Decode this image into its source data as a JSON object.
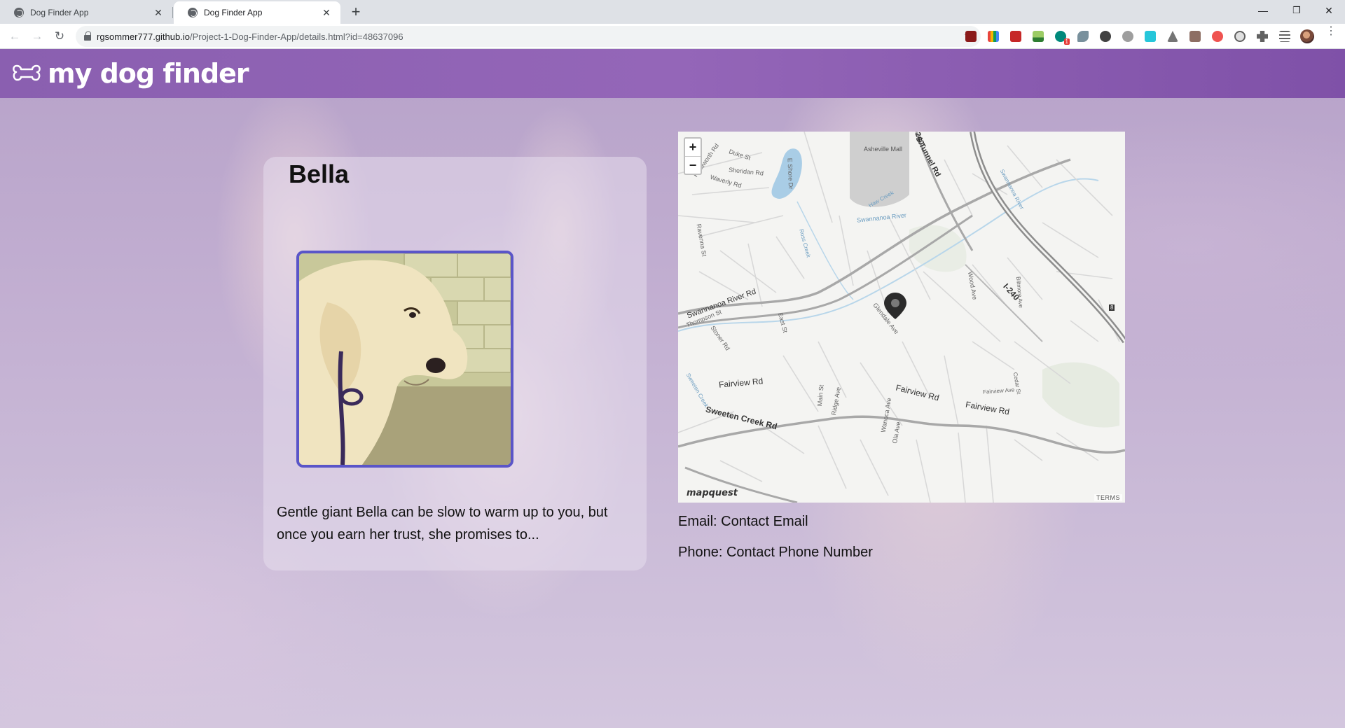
{
  "browser": {
    "tabs": [
      {
        "title": "Dog Finder App",
        "active": false
      },
      {
        "title": "Dog Finder App",
        "active": true
      }
    ],
    "new_tab_symbol": "+",
    "close_symbol": "✕",
    "url_host": "rgsommer777.github.io",
    "url_path": "/Project-1-Dog-Finder-App/details.html?id=48637096",
    "window_controls": {
      "minimize": "—",
      "restore": "❐",
      "close": "✕"
    },
    "extension_badge": "1"
  },
  "site": {
    "brand": "my dog finder",
    "accent_color": "#8a5fb0",
    "photo_border_color": "#5a55c8"
  },
  "dog": {
    "name": "Bella",
    "description": "Gentle giant Bella can be slow to warm up to you, but once you earn her trust, she promises to..."
  },
  "map": {
    "zoom_in": "+",
    "zoom_out": "−",
    "poi": "Asheville Mall",
    "roads": {
      "s_tunnel": "S Tunnel Rd",
      "duke": "Duke St",
      "kenilworth": "Kenilworth Rd",
      "sheridan": "Sheridan Rd",
      "waverly": "Waverly Rd",
      "e_shore": "E Shore Dr",
      "haw_creek": "Haw Creek",
      "swannanoa_river_label": "Swannanoa River",
      "swannanoa_river_north": "Swannanoa River",
      "ravenna": "Ravenna St",
      "ross_creek": "Ross Creek",
      "swannanoa_river_rd": "Swannanoa River Rd",
      "thompson": "Thompson St",
      "east": "East St",
      "stoner": "Stoner Rd",
      "glendale": "Glendale Ave",
      "wood": "Wood Ave",
      "i240": "I-240",
      "i240_top": "240",
      "biltmore": "Biltmore Ave",
      "fairview_w": "Fairview Rd",
      "fairview_c": "Fairview Rd",
      "fairview_e": "Fairview Rd",
      "fairview_ave": "Fairview Ave",
      "cedar": "Cedar St",
      "sweeten_creek": "Sweeten Creek Rd",
      "sweeten_creek_small": "Sweeten Creek",
      "main": "Main St",
      "ridge": "Ridge Ave",
      "wanoca": "Wanoca Ave",
      "ola": "Ola Ave",
      "route_8": "8"
    },
    "attribution": "mapquest",
    "terms": "TERMS"
  },
  "contact": {
    "email": "Email: Contact Email",
    "phone": "Phone: Contact Phone Number"
  }
}
